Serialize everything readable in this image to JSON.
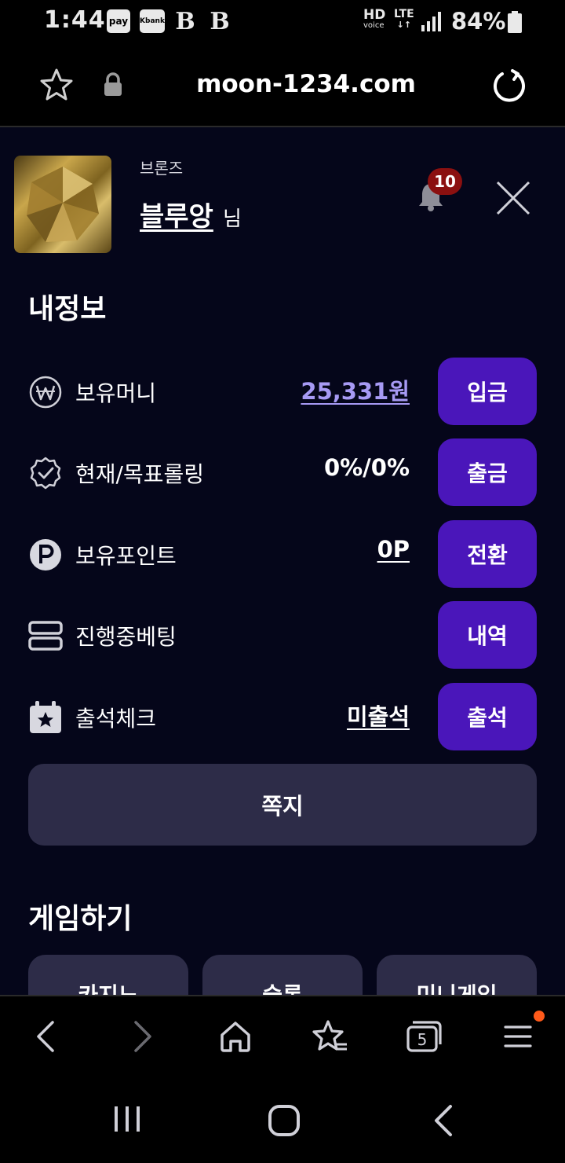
{
  "status_bar": {
    "time": "1:44",
    "notif_icons": [
      "pay",
      "Kbank",
      "B",
      "B"
    ],
    "network_hd": "HD",
    "network_hd_sub": "voice",
    "network_lte": "LTE",
    "network_lte_arrows": "↓↑",
    "battery": "84%"
  },
  "browser": {
    "url": "moon-1234.com"
  },
  "profile": {
    "rank": "브론즈",
    "username": "블루앙",
    "username_suffix": "님",
    "notification_count": "10"
  },
  "my_info": {
    "title": "내정보",
    "rows": [
      {
        "icon": "won-icon",
        "label": "보유머니",
        "value": "25,331원",
        "button": "입금"
      },
      {
        "icon": "verified-badge-icon",
        "label": "현재/목표롤링",
        "value": "0%/0%",
        "button": "출금"
      },
      {
        "icon": "point-icon",
        "label": "보유포인트",
        "value": "0P",
        "button": "전환"
      },
      {
        "icon": "server-icon",
        "label": "진행중베팅",
        "value": "",
        "button": "내역"
      },
      {
        "icon": "calendar-star-icon",
        "label": "출석체크",
        "value": "미출석",
        "button": "출석"
      }
    ],
    "message_button": "쪽지"
  },
  "games": {
    "title": "게임하기",
    "tabs": [
      "카지노",
      "슬롯",
      "미니게임"
    ]
  },
  "colors": {
    "panel_bg": "#05061a",
    "accent_button": "#4a16ba",
    "secondary_button": "#2d2c48",
    "money_value": "#a79af4",
    "badge_red": "#8b1010",
    "nav_dot": "#ff5a1a"
  }
}
